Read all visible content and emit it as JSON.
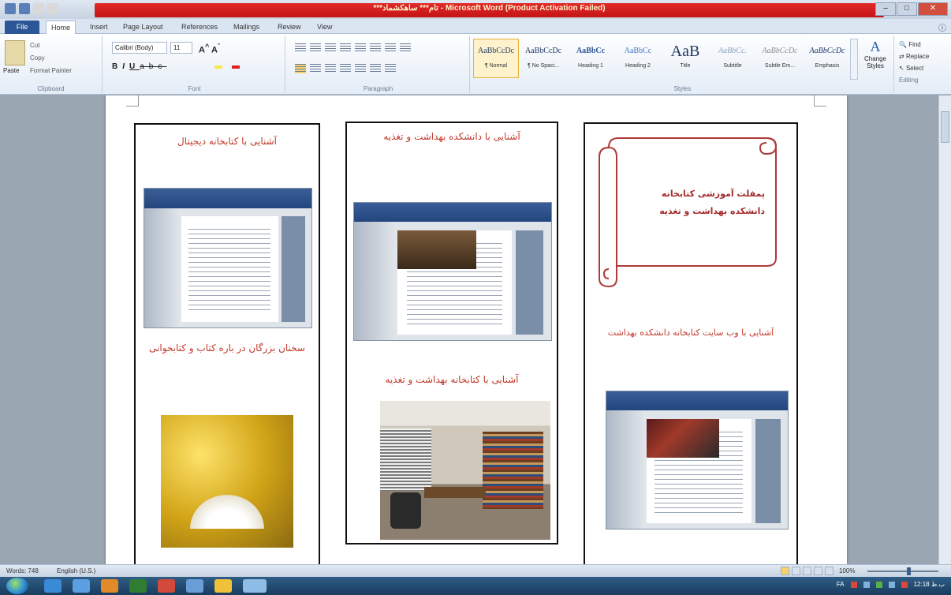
{
  "window": {
    "title": "***تام*** ساهکشماد - Microsoft Word (Product Activation Failed)"
  },
  "ribbon": {
    "tabs": [
      "File",
      "Home",
      "Insert",
      "Page Layout",
      "References",
      "Mailings",
      "Review",
      "View"
    ],
    "clipboard": {
      "paste": "Paste",
      "cut": "Cut",
      "copy": "Copy",
      "format_painter": "Format Painter",
      "label": "Clipboard"
    },
    "font": {
      "family": "Calibri (Body)",
      "size": "11",
      "label": "Font"
    },
    "paragraph_label": "Paragraph",
    "styles": [
      {
        "sample": "AaBbCcDc",
        "name": "¶ Normal"
      },
      {
        "sample": "AaBbCcDc",
        "name": "¶ No Spaci..."
      },
      {
        "sample": "AaBbCc",
        "name": "Heading 1"
      },
      {
        "sample": "AaBbCc",
        "name": "Heading 2"
      },
      {
        "sample": "AaB",
        "name": "Title"
      },
      {
        "sample": "AaBbCc.",
        "name": "Subtitle"
      },
      {
        "sample": "AaBbCcDc",
        "name": "Subtle Em..."
      },
      {
        "sample": "AaBbCcDc",
        "name": "Emphasis"
      }
    ],
    "styles_label": "Styles",
    "change_styles": "Change Styles",
    "editing": {
      "find": "Find",
      "replace": "Replace",
      "select": "Select",
      "label": "Editing"
    }
  },
  "document": {
    "panel_left": {
      "title": "آشنایی با کتابخانه دیجیتال",
      "caption": "سخنان بزرگان در باره کتاب و کتابخوانی"
    },
    "panel_middle": {
      "title": "آشنایی با دانشکده بهداشت و تغذیه",
      "caption": "آشنایی با کتابخانه بهداشت و تغذیه"
    },
    "panel_right": {
      "scroll_text": "پمفلت آموزشی کتابخانه دانشکده بهداشت و تغذیه",
      "caption": "آشنایی با وب سایت کتابخانه دانشکده بهداشت"
    }
  },
  "statusbar": {
    "words": "Words: 748",
    "language": "English (U.S.)",
    "zoom": "100%"
  },
  "taskbar": {
    "lang": "FA",
    "time": "12:18 ب.ظ"
  },
  "colors": {
    "title_red": "#c41414",
    "doc_text_red": "#c0392b",
    "scroll_outline": "#b03a3a"
  }
}
